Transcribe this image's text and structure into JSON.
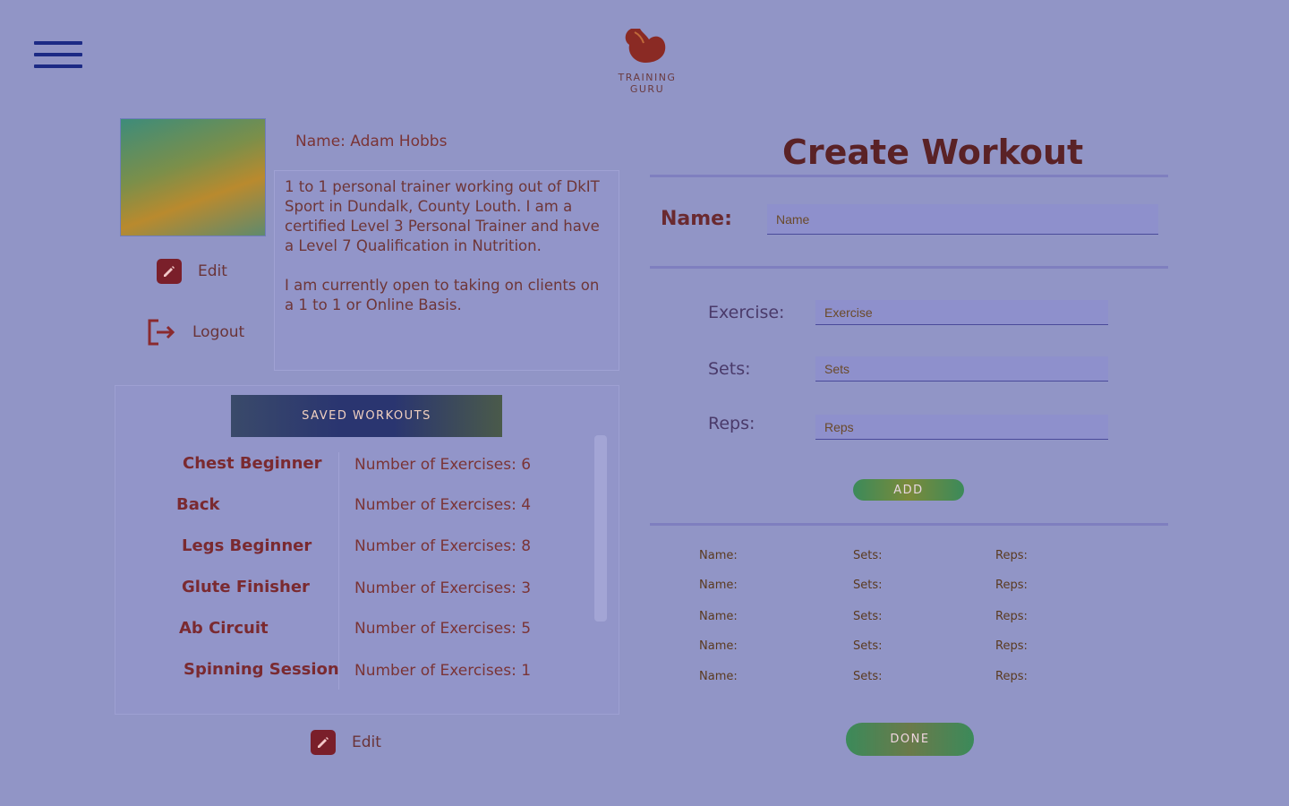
{
  "header": {
    "brand": "TRAINING GURU"
  },
  "profile": {
    "name_label": "Name:",
    "name_value": "Adam Hobbs",
    "bio_p1": "1 to 1 personal trainer working out of DkIT Sport in Dundalk, County Louth. I am a certified Level 3 Personal Trainer and have a Level 7 Qualification in Nutrition.",
    "bio_p2": "I am currently open to taking on clients on a 1 to 1 or Online Basis.",
    "edit_label": "Edit",
    "logout_label": "Logout"
  },
  "saved": {
    "header_label": "SAVED WORKOUTS",
    "workouts": [
      {
        "name": "Chest Beginner",
        "count": "Number of Exercises: 6"
      },
      {
        "name": "Back",
        "count": "Number of Exercises: 4"
      },
      {
        "name": "Legs Beginner",
        "count": "Number of Exercises: 8"
      },
      {
        "name": "Glute Finisher",
        "count": "Number of Exercises: 3"
      },
      {
        "name": "Ab Circuit",
        "count": "Number of Exercises: 5"
      },
      {
        "name": "Spinning Session",
        "count": "Number of Exercises: 1"
      }
    ],
    "edit_label": "Edit"
  },
  "create": {
    "title": "Create Workout",
    "name_label": "Name:",
    "name_placeholder": "Name",
    "exercise_label": "Exercise:",
    "exercise_placeholder": "Exercise",
    "sets_label": "Sets:",
    "sets_placeholder": "Sets",
    "reps_label": "Reps:",
    "reps_placeholder": "Reps",
    "add_label": "ADD",
    "done_label": "DONE",
    "rows": [
      {
        "name": "Name:",
        "sets": "Sets:",
        "reps": "Reps:"
      },
      {
        "name": "Name:",
        "sets": "Sets:",
        "reps": "Reps:"
      },
      {
        "name": "Name:",
        "sets": "Sets:",
        "reps": "Reps:"
      },
      {
        "name": "Name:",
        "sets": "Sets:",
        "reps": "Reps:"
      },
      {
        "name": "Name:",
        "sets": "Sets:",
        "reps": "Reps:"
      }
    ]
  },
  "colors": {
    "background": "#9195c6",
    "accent": "#7a1f2a",
    "menu": "#1c2a85"
  }
}
